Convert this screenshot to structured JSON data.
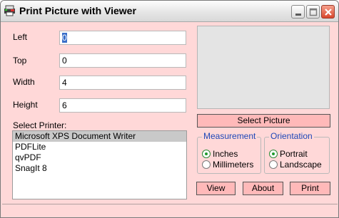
{
  "window": {
    "title": "Print Picture with Viewer"
  },
  "fields": {
    "left": {
      "label": "Left",
      "value": "0"
    },
    "top": {
      "label": "Top",
      "value": "0"
    },
    "width": {
      "label": "Width",
      "value": "4"
    },
    "height": {
      "label": "Height",
      "value": "6"
    }
  },
  "printer": {
    "label": "Select Printer:",
    "items": [
      "Microsoft XPS Document Writer",
      "PDFLite",
      "qvPDF",
      "SnagIt 8"
    ],
    "selected": "Microsoft XPS Document Writer"
  },
  "buttons": {
    "select_picture": "Select Picture",
    "view": "View",
    "about": "About",
    "print": "Print"
  },
  "measurement": {
    "legend": "Measurement",
    "options": [
      "Inches",
      "Millimeters"
    ],
    "selected": "Inches"
  },
  "orientation": {
    "legend": "Orientation",
    "options": [
      "Portrait",
      "Landscape"
    ],
    "selected": "Portrait"
  },
  "colors": {
    "background": "#ffd8d8",
    "button": "#ffb9b9",
    "legend_text": "#1e47b8",
    "radio_on": "#1f9a2c"
  }
}
